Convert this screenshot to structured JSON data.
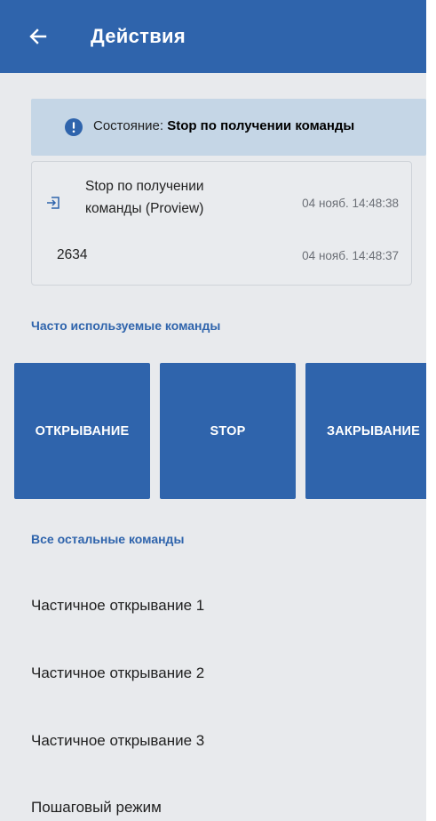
{
  "appbar": {
    "title": "Действия",
    "back_icon": "arrow-left-icon",
    "color": "#2f64ac"
  },
  "status": {
    "label": "Состояние:",
    "value": "Stop по получении команды",
    "icon": "info-icon"
  },
  "log": {
    "entries": [
      {
        "text": "Stop по получении команды (Proview)",
        "time": "04 нояб. 14:48:38",
        "icon": "sign-in-icon"
      },
      {
        "text": "2634",
        "time": "04 нояб. 14:48:37"
      }
    ]
  },
  "favorites": {
    "title": "Часто используемые команды",
    "commands": [
      {
        "label": "ОТКРЫВАНИЕ"
      },
      {
        "label": "STOP"
      },
      {
        "label": "ЗАКРЫВАНИЕ"
      }
    ]
  },
  "others": {
    "title": "Все остальные команды",
    "commands": [
      {
        "label": "Частичное открывание 1"
      },
      {
        "label": "Частичное открывание 2"
      },
      {
        "label": "Частичное открывание 3"
      },
      {
        "label": "Пошаговый режим"
      }
    ]
  }
}
